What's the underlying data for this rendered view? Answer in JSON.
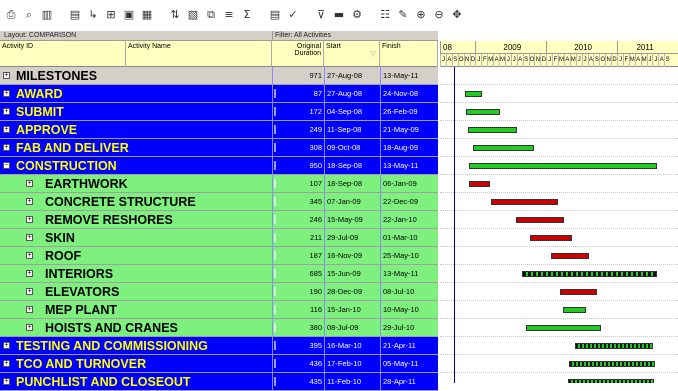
{
  "toolbar": {
    "icons": [
      "print-icon",
      "print-preview-icon",
      "columns-icon",
      "bars-icon",
      "relationship-icon",
      "tree-icon",
      "layout-icon",
      "group-icon",
      "sort-icon",
      "filter-icon",
      "schedule-icon",
      "level-icon",
      "summarize-icon",
      "reports-icon",
      "spelling-icon",
      "filter-funnel-icon",
      "view-icon",
      "progress-icon",
      "resources-icon",
      "tools-icon",
      "zoom-in-icon",
      "zoom-out-icon",
      "pan-icon"
    ]
  },
  "layout_label": "Layout: COMPARISON",
  "filter_label": "Filter: All Activities",
  "columns": {
    "activity_id": "Activity ID",
    "activity_name": "Activity Name",
    "duration_line1": "Original",
    "duration_line2": "Duration",
    "start": "Start",
    "finish": "Finish"
  },
  "gantt_header": {
    "years": [
      "08",
      "2009",
      "2010",
      "2011"
    ],
    "months": [
      "J",
      "A",
      "S",
      "O",
      "N",
      "D",
      "J",
      "F",
      "M",
      "A",
      "M",
      "J",
      "J",
      "A",
      "S",
      "O",
      "N",
      "D",
      "J",
      "F",
      "M",
      "A",
      "M",
      "J",
      "J",
      "A",
      "S",
      "O",
      "N",
      "D",
      "J",
      "F",
      "M",
      "A",
      "M",
      "J",
      "J",
      "A",
      "S"
    ]
  },
  "rows": [
    {
      "level": "top",
      "name": "MILESTONES",
      "duration": "971",
      "start": "27-Aug-08",
      "finish": "13-May-11"
    },
    {
      "level": "wbs1",
      "name": "AWARD",
      "duration": "87",
      "start": "27-Aug-08",
      "finish": "24-Nov-08"
    },
    {
      "level": "wbs1",
      "name": "SUBMIT",
      "duration": "172",
      "start": "04-Sep-08",
      "finish": "26-Feb-09"
    },
    {
      "level": "wbs1",
      "name": "APPROVE",
      "duration": "249",
      "start": "11-Sep-08",
      "finish": "21-May-09"
    },
    {
      "level": "wbs1",
      "name": "FAB AND DELIVER",
      "duration": "308",
      "start": "09-Oct-08",
      "finish": "18-Aug-09"
    },
    {
      "level": "wbs1",
      "name": "CONSTRUCTION",
      "duration": "950",
      "start": "18-Sep-08",
      "finish": "13-May-11"
    },
    {
      "level": "wbs2",
      "name": "EARTHWORK",
      "duration": "107",
      "start": "18-Sep-08",
      "finish": "06-Jan-09"
    },
    {
      "level": "wbs2",
      "name": "CONCRETE STRUCTURE",
      "duration": "345",
      "start": "07-Jan-09",
      "finish": "22-Dec-09"
    },
    {
      "level": "wbs2",
      "name": "REMOVE RESHORES",
      "duration": "246",
      "start": "15-May-09",
      "finish": "22-Jan-10"
    },
    {
      "level": "wbs2",
      "name": "SKIN",
      "duration": "211",
      "start": "29-Jul-09",
      "finish": "01-Mar-10"
    },
    {
      "level": "wbs2",
      "name": "ROOF",
      "duration": "187",
      "start": "16-Nov-09",
      "finish": "25-May-10"
    },
    {
      "level": "wbs2",
      "name": "INTERIORS",
      "duration": "685",
      "start": "15-Jun-09",
      "finish": "13-May-11"
    },
    {
      "level": "wbs2",
      "name": "ELEVATORS",
      "duration": "190",
      "start": "28-Dec-09",
      "finish": "08-Jul-10"
    },
    {
      "level": "wbs2",
      "name": "MEP PLANT",
      "duration": "116",
      "start": "15-Jan-10",
      "finish": "10-May-10"
    },
    {
      "level": "wbs2",
      "name": "HOISTS AND CRANES",
      "duration": "380",
      "start": "08-Jul-09",
      "finish": "29-Jul-10"
    },
    {
      "level": "wbs1",
      "name": "TESTING AND COMMISSIONING",
      "duration": "395",
      "start": "16-Mar-10",
      "finish": "21-Apr-11"
    },
    {
      "level": "wbs1",
      "name": "TCO AND TURNOVER",
      "duration": "436",
      "start": "17-Feb-10",
      "finish": "05-May-11"
    },
    {
      "level": "wbs1",
      "name": "PUNCHLIST AND CLOSEOUT",
      "duration": "435",
      "start": "11-Feb-10",
      "finish": "28-Apr-11"
    }
  ],
  "colors": {
    "wbs1_band": "#0000ff",
    "wbs1_text": "#ffff00",
    "wbs2_band": "#7ef07e",
    "bar_green": "#22cc22",
    "bar_red": "#cc0000",
    "header_yellow": "#ffffc0"
  }
}
